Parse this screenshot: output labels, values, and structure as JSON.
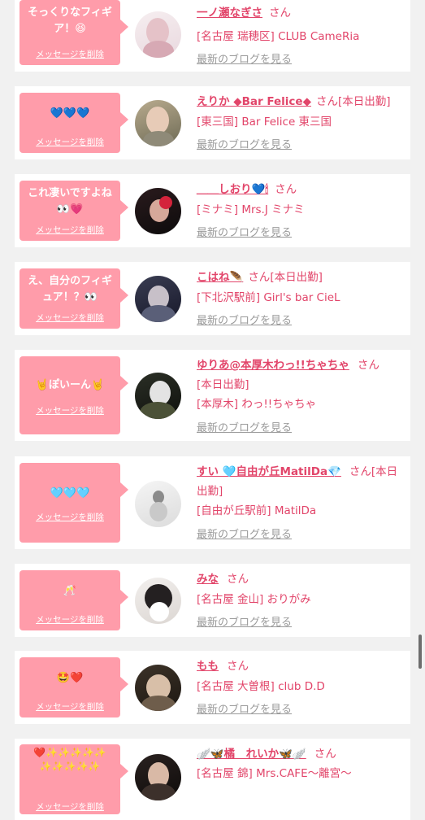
{
  "delete_label": "メッセージを削除",
  "blog_label": "最新のブログを見る",
  "san": "さん",
  "cards": [
    {
      "message": "そっくりなフィギア！😆",
      "name": "一ノ瀬なぎさ",
      "status": "",
      "shop": "[名古屋 瑞穂区] CLUB CameRia"
    },
    {
      "message": "💙💙💙",
      "name": "えりか ◆Bar Felice◆",
      "status": "[本日出勤]",
      "shop": "[東三国] Bar Felice 東三国"
    },
    {
      "message": "これ凄いですよね👀💗",
      "name": "＿＿しおり💙🕯",
      "status": "",
      "shop": "[ミナミ] Mrs.J ミナミ"
    },
    {
      "message": "え、自分のフィギュア！？👀",
      "name": "こはね🪶",
      "status": "[本日出勤]",
      "shop": "[下北沢駅前] Girl's bar CieL"
    },
    {
      "message": "🤘ぽいーん🤘",
      "name": "ゆりあ@本厚木わっ!!ちゃちゃ",
      "status": "[本日出勤]",
      "shop": "[本厚木] わっ!!ちゃちゃ"
    },
    {
      "message": "🩵🩵🩵",
      "name": "すい 🩵自由が丘MatilDa💎",
      "status": "[本日出勤]",
      "shop": "[自由が丘駅前] MatilDa"
    },
    {
      "message": "🥂",
      "name": "みな",
      "status": "",
      "shop": "[名古屋 金山] おりがみ"
    },
    {
      "message": "🤩❤️",
      "name": "もも",
      "status": "",
      "shop": "[名古屋 大曽根] club D.D"
    },
    {
      "message": "❤️✨✨✨✨✨✨✨✨✨✨",
      "name": "🪽🦋橘　れいか🦋🪽",
      "status": "",
      "shop": "[名古屋 錦] Mrs.CAFE〜離宮〜"
    }
  ],
  "colors": {
    "page_bg": "#f1f1f1",
    "bubble": "#ff9caa",
    "name": "#e2456a",
    "blog_link": "#9a9a9a"
  }
}
